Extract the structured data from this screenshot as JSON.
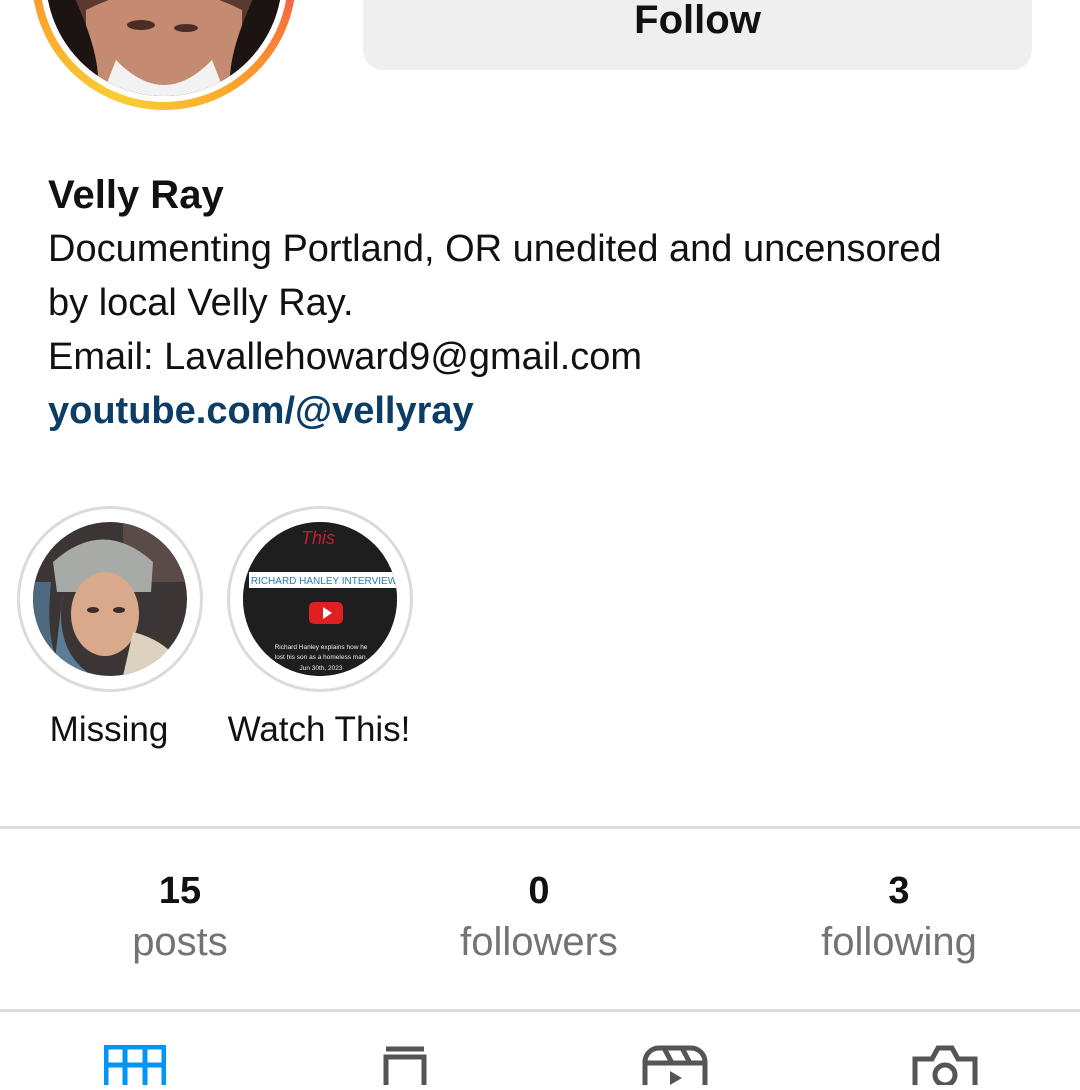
{
  "profile": {
    "follow_label": "Follow",
    "name": "Velly Ray",
    "bio_line1": "Documenting Portland, OR unedited and uncensored",
    "bio_line2": "by local Velly Ray.",
    "email_line": "Email: Lavallehoward9@gmail.com",
    "link": "youtube.com/@vellyray"
  },
  "highlights": [
    {
      "label": "Missing"
    },
    {
      "label": "Watch This!",
      "cover": {
        "script": "This",
        "banner": "RICHARD HANLEY INTERVIEW",
        "caption1": "Richard Hanley explains how he",
        "caption2": "lost his son as a homeless man.",
        "date": "Jun 30th, 2023"
      }
    }
  ],
  "stats": [
    {
      "value": "15",
      "label": "posts"
    },
    {
      "value": "0",
      "label": "followers"
    },
    {
      "value": "3",
      "label": "following"
    }
  ],
  "tabs": [
    {
      "icon": "grid-icon",
      "active": true
    },
    {
      "icon": "clipboard-icon",
      "active": false
    },
    {
      "icon": "reels-icon",
      "active": false
    },
    {
      "icon": "tagged-icon",
      "active": false
    }
  ],
  "colors": {
    "active_tab": "#0095f6",
    "inactive_tab": "#555555",
    "link": "#0b3d66",
    "secondary_text": "#737373"
  }
}
